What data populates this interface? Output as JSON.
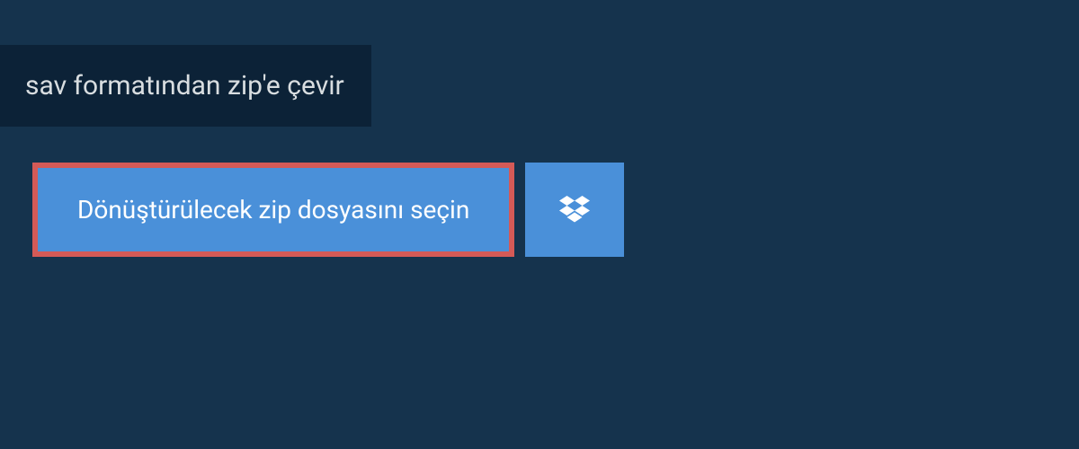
{
  "header": {
    "title": "sav formatından zip'e çevir"
  },
  "main": {
    "select_button_label": "Dönüştürülecek zip dosyasını seçin"
  },
  "colors": {
    "background": "#15334d",
    "header_background": "#0c2237",
    "button_background": "#4a90d9",
    "highlight_border": "#d45a57"
  }
}
